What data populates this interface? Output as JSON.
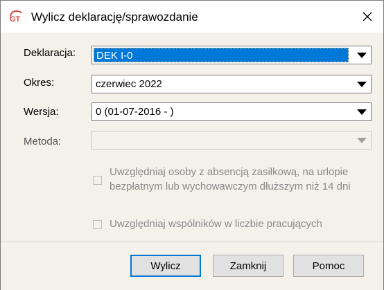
{
  "window": {
    "title": "Wylicz deklarację/sprawozdanie"
  },
  "form": {
    "deklaracja": {
      "label": "Deklaracja:",
      "value": "DEK I-0"
    },
    "okres": {
      "label": "Okres:",
      "value": "czerwiec 2022"
    },
    "wersja": {
      "label": "Wersja:",
      "value": "0 (01-07-2016 - )"
    },
    "metoda": {
      "label": "Metoda:",
      "value": ""
    },
    "checkbox_absencja": {
      "line1": "Uwzględniaj osoby z absencją zasiłkową, na urlopie",
      "line2": "bezpłatnym lub wychowawczym dłuższym niż 14 dni",
      "checked": false
    },
    "checkbox_wspolnicy": {
      "label": "Uwzględniaj wspólników w liczbie pracujących",
      "checked": false
    }
  },
  "buttons": {
    "wylicz": "Wylicz",
    "zamknij": "Zamknij",
    "pomoc": "Pomoc"
  },
  "colors": {
    "selection": "#0078d7",
    "dialog_bg": "#f4f1ea",
    "default_button_border": "#0078d7"
  }
}
